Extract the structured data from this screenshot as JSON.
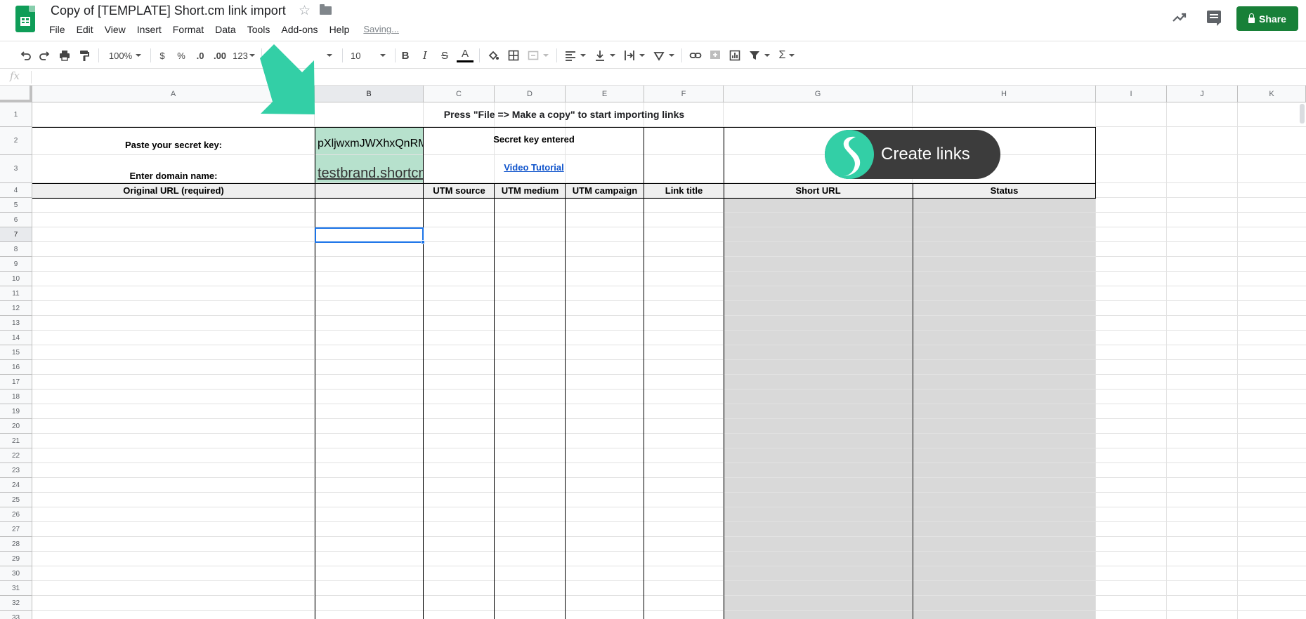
{
  "header": {
    "doc_title": "Copy of [TEMPLATE] Short.cm link import",
    "menu": [
      "File",
      "Edit",
      "View",
      "Insert",
      "Format",
      "Data",
      "Tools",
      "Add-ons",
      "Help"
    ],
    "saving_status": "Saving...",
    "share_label": "Share"
  },
  "toolbar": {
    "zoom": "100%",
    "currency": "$",
    "percent": "%",
    "dec_decrease": ".0",
    "dec_increase": ".00",
    "more_formats": "123",
    "font_size": "10",
    "bold": "B",
    "italic": "I",
    "strike": "S",
    "text_color": "A",
    "sigma": "Σ"
  },
  "formula_bar": {
    "fx": "fx"
  },
  "grid": {
    "columns": [
      "A",
      "B",
      "C",
      "D",
      "E",
      "F",
      "G",
      "H",
      "I",
      "J",
      "K"
    ],
    "rows": [
      "1",
      "2",
      "3",
      "4",
      "5",
      "6",
      "7",
      "8",
      "9",
      "10",
      "11",
      "12",
      "13",
      "14",
      "15",
      "16",
      "17",
      "18",
      "19",
      "20",
      "21",
      "22",
      "23",
      "24",
      "25",
      "26",
      "27",
      "28",
      "29",
      "30",
      "31",
      "32",
      "33"
    ],
    "selected_column": "B",
    "selected_row": "7"
  },
  "sheet": {
    "banner": "Press \"File => Make a copy\" to start importing links",
    "secret_key_label": "Paste your secret key:",
    "secret_key_value": "pXljwxmJWXhxQnRM",
    "domain_label": "Enter domain name:",
    "domain_value": "testbrand.shortcm.li",
    "secret_status": "Secret key entered",
    "video_link": "Video Tutorial",
    "create_links": "Create links",
    "headers": {
      "original_url": "Original URL (required)",
      "utm_source": "UTM source",
      "utm_medium": "UTM medium",
      "utm_campaign": "UTM campaign",
      "link_title": "Link title",
      "short_url": "Short URL",
      "status": "Status"
    }
  },
  "colors": {
    "brand_green": "#188038",
    "sheet_green": "#0f9d58",
    "accent_teal": "#33cfa6",
    "cell_green": "#b7e1cd",
    "gray_fill": "#d9d9d9"
  }
}
